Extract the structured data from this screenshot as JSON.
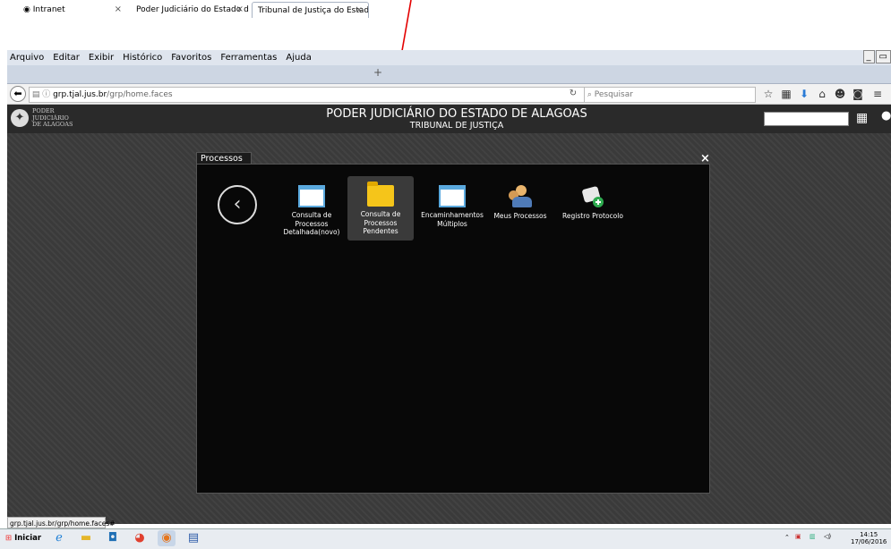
{
  "menu": [
    "Arquivo",
    "Editar",
    "Exibir",
    "Histórico",
    "Favoritos",
    "Ferramentas",
    "Ajuda"
  ],
  "window_controls": [
    "_",
    "ᴀ",
    "□"
  ],
  "tabs": [
    {
      "label": "Intranet",
      "close": "×"
    },
    {
      "label": "Poder Judiciário do Estado de ...",
      "close": "×"
    },
    {
      "label": "Tribunal de Justiça do Estado d...",
      "close": "×"
    }
  ],
  "newtab": "+",
  "url": {
    "host": "grp.tjal.jus.br",
    "path": "/grp/home.faces"
  },
  "search_placeholder": "Pesquisar",
  "header": {
    "logo_lines": [
      "PODER",
      "JUDICIÁRIO",
      "DE ALAGOAS"
    ],
    "title": "PODER JUDICIÁRIO DO ESTADO DE ALAGOAS",
    "subtitle": "TRIBUNAL DE JUSTIÇA"
  },
  "panel": {
    "tab": "Processos",
    "close": "×",
    "apps": [
      {
        "label": "Consulta de Processos Detalhada(novo)",
        "icon": "window-icon"
      },
      {
        "label": "Consulta de Processos Pendentes",
        "icon": "folder-icon",
        "selected": true
      },
      {
        "label": "Encaminhamentos Múltiplos",
        "icon": "window-icon"
      },
      {
        "label": "Meus Processos",
        "icon": "people-icon"
      },
      {
        "label": "Registro Protocolo",
        "icon": "scroll-add-icon"
      }
    ]
  },
  "status_url": "grp.tjal.jus.br/grp/home.faces#",
  "taskbar": {
    "start": "Iniciar",
    "time": "14:15",
    "date": "17/06/2016"
  },
  "colors": {
    "annotation_arrow": "#e30000",
    "header_bg": "#2a2a2a",
    "panel_bg": "#080808",
    "folder": "#f5c51a",
    "window_border": "#5aa9de"
  }
}
